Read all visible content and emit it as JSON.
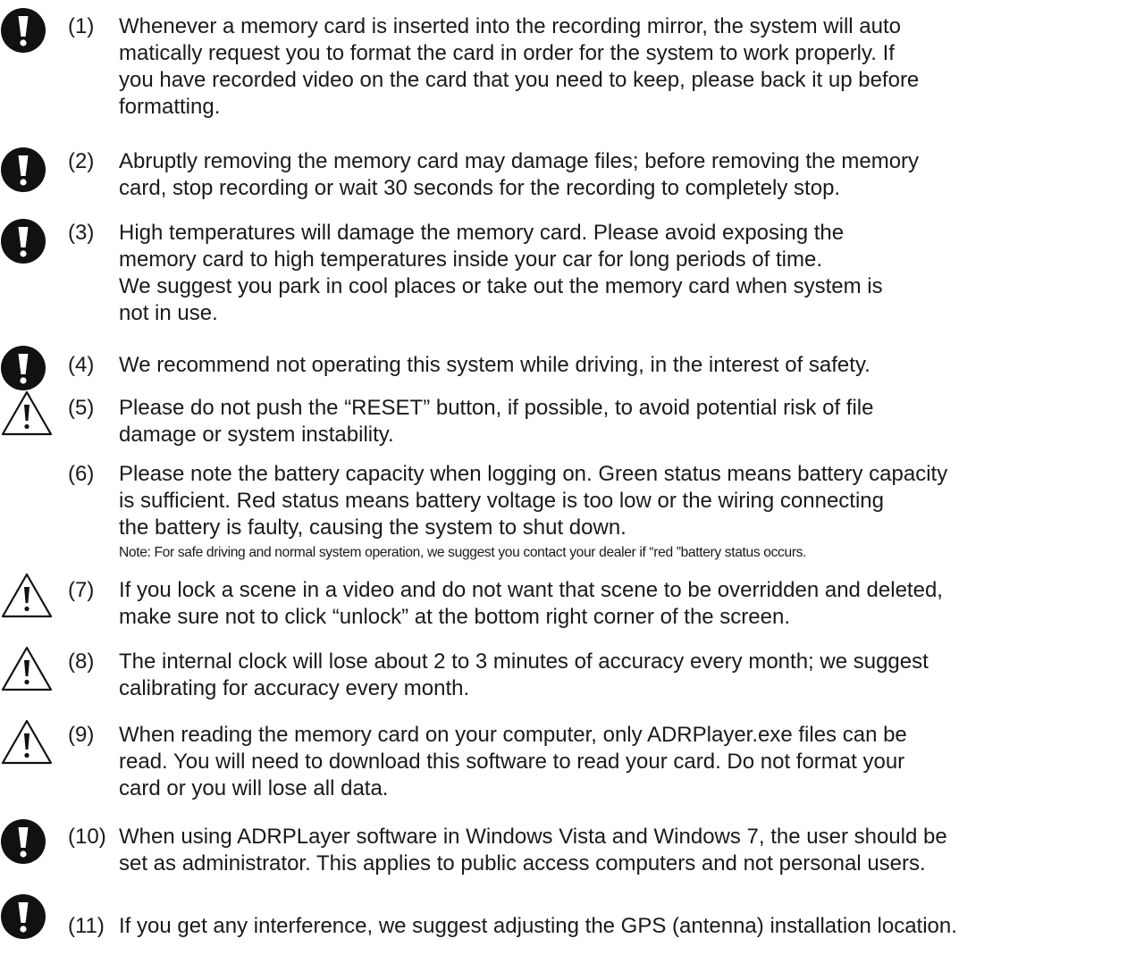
{
  "items": [
    {
      "icon": "exclamation-circle-icon",
      "number": "(1)",
      "text": "Whenever a memory card is inserted into the recording mirror, the system will auto\nmatically request you to format the card in order for the system to work properly. If\nyou have recorded video on the card that you need to keep, please back it up before\nformatting."
    },
    {
      "icon": "exclamation-circle-icon",
      "number": "(2)",
      "text": "Abruptly removing the memory card may damage files; before removing the memory\ncard, stop recording or wait 30 seconds for the recording to completely stop."
    },
    {
      "icon": "exclamation-circle-icon",
      "number": "(3)",
      "text": "High temperatures will damage the memory card. Please avoid exposing the\nmemory card to high temperatures inside your car for long periods of time.\nWe suggest you park in cool places or take out the memory card when system is\nnot in use."
    },
    {
      "icon": "exclamation-circle-icon",
      "number": "(4)",
      "text": "We recommend not operating this system while driving, in the interest of safety."
    },
    {
      "icon": "warning-triangle-icon",
      "number": "(5)",
      "text": "Please do not push the “RESET” button, if possible, to avoid potential risk of file\ndamage or system instability."
    },
    {
      "icon": "",
      "number": "(6)",
      "text": "Please note the battery capacity when logging on. Green status means battery capacity\nis sufficient. Red status means battery voltage is too low or the wiring connecting\nthe battery is faulty, causing the system to shut down.",
      "note": "Note: For safe driving and normal system operation, we suggest you contact your dealer if “red ”battery status occurs."
    },
    {
      "icon": "warning-triangle-icon",
      "number": "(7)",
      "text": "If you lock a scene in a video and do not want that scene to be overridden and deleted,\nmake sure not to click “unlock” at the bottom right corner of the screen."
    },
    {
      "icon": "warning-triangle-icon",
      "number": "(8)",
      "text": "The internal clock will lose about 2 to 3 minutes of accuracy every month; we suggest\ncalibrating for accuracy every month."
    },
    {
      "icon": "warning-triangle-icon",
      "number": "(9)",
      "text": "When reading the memory card on your computer, only ADRPlayer.exe files can be\nread. You will need to download this software to read your card. Do not format your\ncard or you will lose all data."
    },
    {
      "icon": "exclamation-circle-icon",
      "number": "(10)",
      "text": "When using ADRPLayer software in Windows Vista and Windows 7, the user should be\nset as administrator. This applies to public access computers and not personal users."
    },
    {
      "icon": "exclamation-circle-icon",
      "number": "(11)",
      "text": "If you get any interference, we suggest adjusting the GPS (antenna) installation location."
    }
  ]
}
